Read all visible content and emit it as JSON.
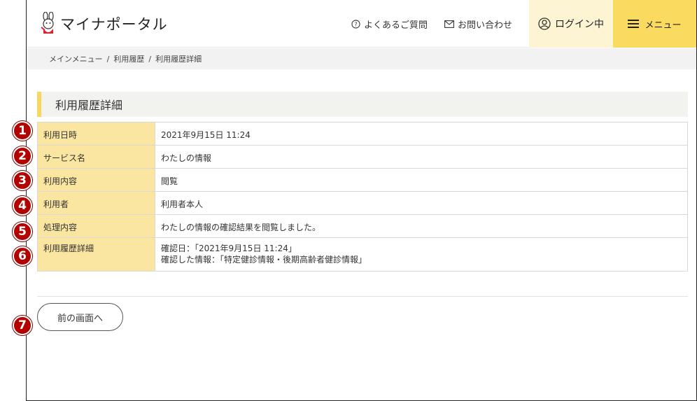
{
  "header": {
    "logo_text": "マイナポータル",
    "faq_label": "よくあるご質問",
    "contact_label": "お問い合わせ",
    "login_label": "ログイン中",
    "menu_label": "メニュー"
  },
  "breadcrumb": {
    "items": [
      "メインメニュー",
      "利用履歴",
      "利用履歴詳細"
    ],
    "separator": "/"
  },
  "page_title": "利用履歴詳細",
  "details": {
    "rows": [
      {
        "label": "利用日時",
        "value": "2021年9月15日 11:24"
      },
      {
        "label": "サービス名",
        "value": "わたしの情報"
      },
      {
        "label": "利用内容",
        "value": "閲覧"
      },
      {
        "label": "利用者",
        "value": "利用者本人"
      },
      {
        "label": "処理内容",
        "value": "わたしの情報の確認結果を閲覧しました。"
      },
      {
        "label": "利用履歴詳細",
        "value_line1": "確認日：「2021年9月15日 11:24」",
        "value_line2": "確認した情報：「特定健診情報・後期高齢者健診情報」"
      }
    ]
  },
  "back_button_label": "前の画面へ",
  "markers": [
    "1",
    "2",
    "3",
    "4",
    "5",
    "6",
    "7"
  ],
  "colors": {
    "accent_yellow": "#fadb5f",
    "login_bg": "#fdf4d3",
    "label_bg": "#fae6a0",
    "marker_red": "#b30000"
  },
  "icons": {
    "logo": "mascot-icon",
    "faq": "question-circle-icon",
    "contact": "mail-icon",
    "login": "user-circle-icon",
    "menu": "hamburger-icon"
  }
}
